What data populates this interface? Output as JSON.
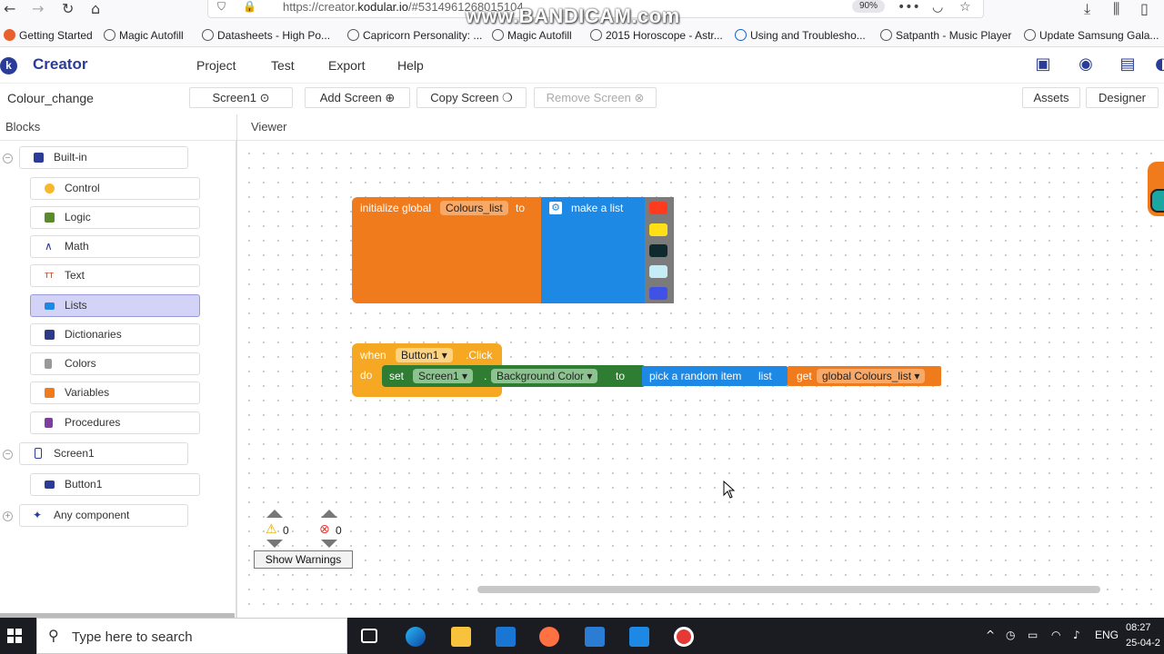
{
  "browser": {
    "url_prefix": "https://creator.",
    "url_domain": "kodular.io",
    "url_suffix": "/#5314961268015104",
    "zoom": "90%",
    "watermark": "www.BANDICAM.com",
    "bookmarks": [
      "Getting Started",
      "Magic Autofill",
      "Datasheets - High Po...",
      "Capricorn Personality: ...",
      "Magic Autofill",
      "2015 Horoscope - Astr...",
      "Using and Troublesho...",
      "Satpanth - Music Player",
      "Update Samsung Gala..."
    ]
  },
  "app": {
    "logo_letter": "k",
    "name": "Creator",
    "menu": [
      "Project",
      "Test",
      "Export",
      "Help"
    ]
  },
  "project": {
    "name": "Colour_change",
    "screen_select": "Screen1",
    "add_screen": "Add Screen",
    "copy_screen": "Copy Screen",
    "remove_screen": "Remove Screen",
    "assets": "Assets",
    "designer": "Designer"
  },
  "panels": {
    "blocks": "Blocks",
    "viewer": "Viewer"
  },
  "tree": {
    "builtin": "Built-in",
    "builtin_items": [
      {
        "label": "Control",
        "color": "#f6b92b"
      },
      {
        "label": "Logic",
        "color": "#5b8a2e"
      },
      {
        "label": "Math",
        "color": "#2d3a8c"
      },
      {
        "label": "Text",
        "color": "#c2563b"
      },
      {
        "label": "Lists",
        "color": "#1e88e5"
      },
      {
        "label": "Dictionaries",
        "color": "#2d3a8c"
      },
      {
        "label": "Colors",
        "color": "#888888"
      },
      {
        "label": "Variables",
        "color": "#f07b1d"
      },
      {
        "label": "Procedures",
        "color": "#7b3fa0"
      }
    ],
    "screen": "Screen1",
    "component": "Button1",
    "any_component": "Any component"
  },
  "blocks": {
    "init_global": "initialize global",
    "var_name": "Colours_list",
    "to": "to",
    "make_list": "make a list",
    "swatches": [
      "#ff3b1f",
      "#ffe016",
      "#0e2a2e",
      "#c6ecf5",
      "#3f51e6"
    ],
    "when": "when",
    "button": "Button1",
    "click": ".Click",
    "do": "do",
    "set": "set",
    "screen": "Screen1",
    "dot": ".",
    "property": "Background Color",
    "to2": "to",
    "pick_random": "pick a random item",
    "list_lbl": "list",
    "get": "get",
    "get_var": "global Colours_list"
  },
  "warnings": {
    "warn_count": "0",
    "error_count": "0",
    "show_warnings": "Show Warnings"
  },
  "taskbar": {
    "search_placeholder": "Type here to search",
    "lang": "ENG",
    "time": "08:27",
    "date": "25-04-2"
  },
  "colors": {
    "accent": "#2a3c98",
    "orange_block": "#f07b1d",
    "blue_block": "#1e88e5",
    "green_block": "#2f7d32",
    "event_block": "#f6a823"
  }
}
